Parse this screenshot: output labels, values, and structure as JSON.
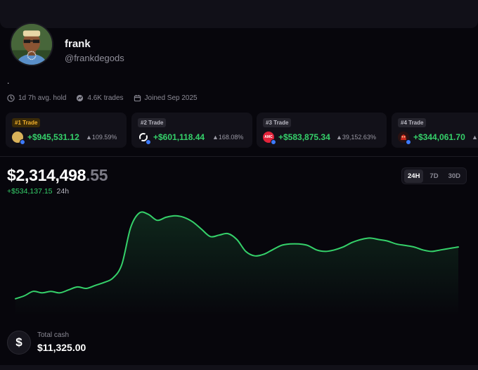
{
  "profile": {
    "name": "frank",
    "handle": "@frankdegods",
    "bio": ".",
    "stats": {
      "avg_hold": "1d 7h avg. hold",
      "trades": "4.6K trades",
      "joined": "Joined Sep 2025"
    }
  },
  "top_trades": [
    {
      "rank": "#1 Trade",
      "gain": "+$945,531.12",
      "pct": "▲109.59%",
      "token_icon": "gold-token-icon",
      "token_color": "#d9b25a"
    },
    {
      "rank": "#2 Trade",
      "gain": "+$601,118.44",
      "pct": "▲168.08%",
      "token_icon": "ring-token-icon",
      "token_color": "#ffffff"
    },
    {
      "rank": "#3 Trade",
      "gain": "+$583,875.34",
      "pct": "▲39,152.63%",
      "token_icon": "amc-token-icon",
      "token_color": "#e3243b",
      "token_text": "AMC"
    },
    {
      "rank": "#4 Trade",
      "gain": "+$344,061.70",
      "pct": "▲",
      "token_icon": "red-creature-token-icon",
      "token_color": "#c8281e"
    }
  ],
  "portfolio": {
    "value_main": "$2,314,498",
    "value_cents": ".55",
    "change_amount": "+$534,137.15",
    "change_period": "24h"
  },
  "range_tabs": [
    {
      "label": "24H",
      "active": true
    },
    {
      "label": "7D",
      "active": false
    },
    {
      "label": "30D",
      "active": false
    }
  ],
  "cash": {
    "label": "Total cash",
    "value": "$11,325.00",
    "icon_symbol": "$"
  },
  "colors": {
    "accent_green": "#35d16a",
    "background": "#07060c",
    "card": "#121119",
    "gold_badge": "#f5b32d"
  },
  "chart_data": {
    "type": "line",
    "title": "",
    "xlabel": "",
    "ylabel": "",
    "x": [
      0,
      1,
      2,
      3,
      4,
      5,
      6,
      7,
      8,
      9,
      10,
      11,
      12,
      13,
      14,
      15,
      16,
      17,
      18,
      19,
      20,
      21,
      22,
      23,
      24,
      25,
      26,
      27,
      28,
      29,
      30,
      31,
      32,
      33,
      34,
      35,
      36,
      37,
      38,
      39,
      40,
      41,
      42,
      43,
      44,
      45,
      46,
      47,
      48,
      49,
      50
    ],
    "series": [
      {
        "values": [
          1.72,
          1.74,
          1.77,
          1.76,
          1.77,
          1.76,
          1.78,
          1.8,
          1.79,
          1.81,
          1.83,
          1.86,
          1.95,
          2.2,
          2.3,
          2.29,
          2.25,
          2.27,
          2.28,
          2.27,
          2.24,
          2.19,
          2.14,
          2.15,
          2.16,
          2.12,
          2.04,
          2.01,
          2.02,
          2.05,
          2.08,
          2.09,
          2.09,
          2.08,
          2.05,
          2.04,
          2.05,
          2.07,
          2.1,
          2.12,
          2.13,
          2.12,
          2.11,
          2.09,
          2.08,
          2.07,
          2.05,
          2.04,
          2.05,
          2.06,
          2.07
        ]
      }
    ],
    "ylim": [
      1.6,
      2.36
    ],
    "grid": false,
    "legend": "none"
  }
}
